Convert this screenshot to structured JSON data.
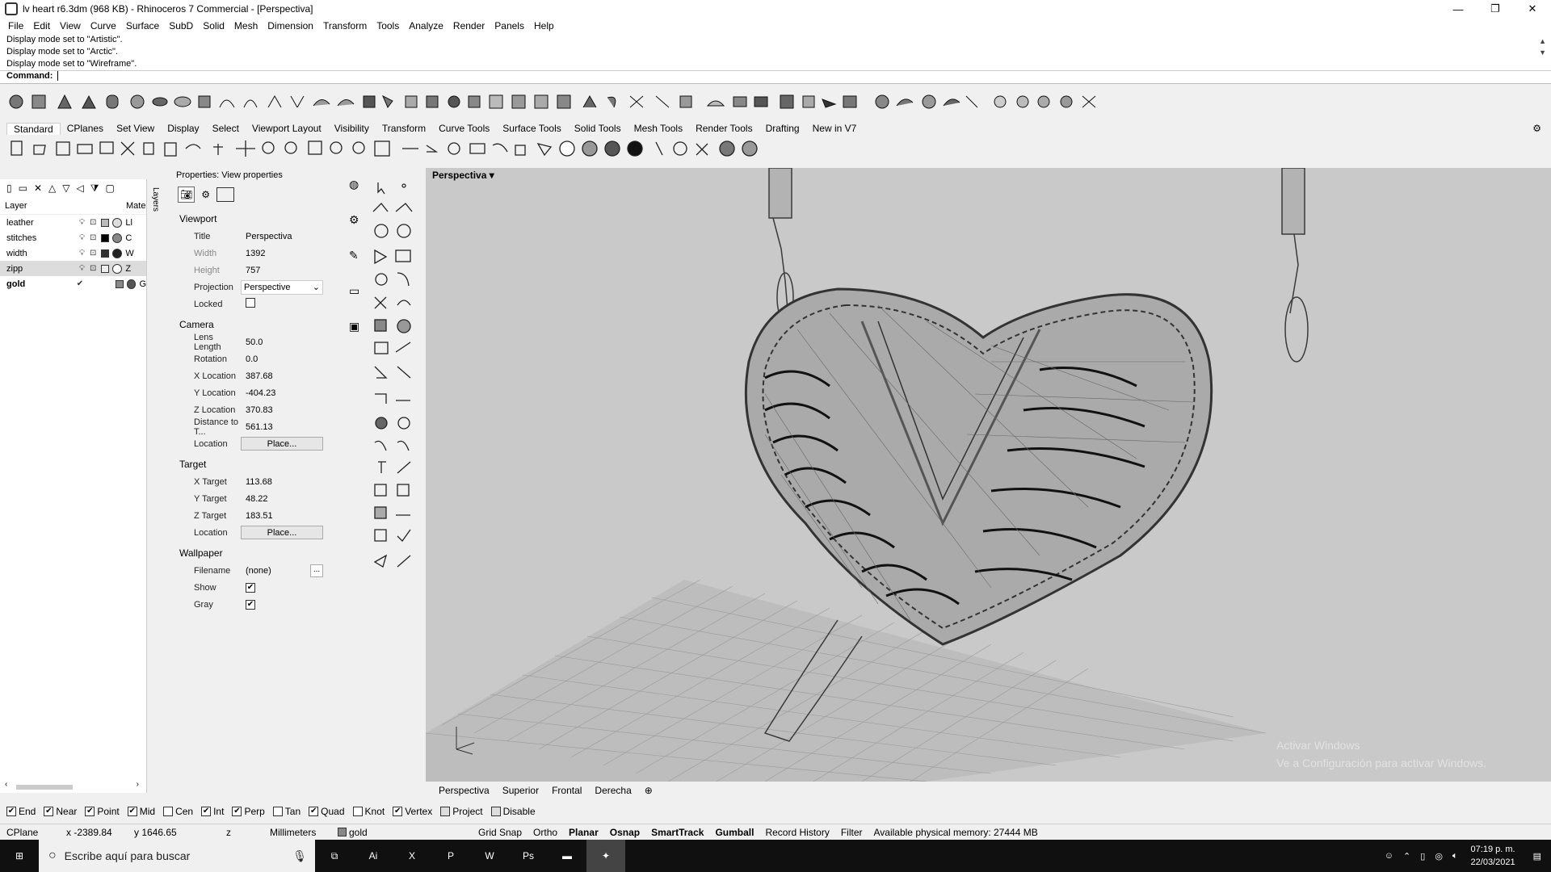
{
  "window": {
    "title": "lv heart r6.3dm (968 KB) - Rhinoceros 7 Commercial - [Perspectiva]",
    "minimize": "—",
    "restore": "❐",
    "close": "✕"
  },
  "menu": [
    "File",
    "Edit",
    "View",
    "Curve",
    "Surface",
    "SubD",
    "Solid",
    "Mesh",
    "Dimension",
    "Transform",
    "Tools",
    "Analyze",
    "Render",
    "Panels",
    "Help"
  ],
  "command_history": [
    "Display mode set to \"Artistic\".",
    "Display mode set to \"Arctic\".",
    "Display mode set to \"Wireframe\"."
  ],
  "command_prompt": "Command:",
  "toolbar_tabs": [
    "Standard",
    "CPlanes",
    "Set View",
    "Display",
    "Select",
    "Viewport Layout",
    "Visibility",
    "Transform",
    "Curve Tools",
    "Surface Tools",
    "Solid Tools",
    "Mesh Tools",
    "Render Tools",
    "Drafting",
    "New in V7"
  ],
  "layers": {
    "tab_label": "Layers",
    "col_layer": "Layer",
    "col_material": "Mate",
    "rows": [
      {
        "name": "leather",
        "mat": "Ll",
        "color": "#bbbbbb"
      },
      {
        "name": "stitches",
        "mat": "C",
        "color": "#000000"
      },
      {
        "name": "width",
        "mat": "W",
        "color": "#333333"
      },
      {
        "name": "zipp",
        "mat": "Z",
        "color": "#eeeeee"
      },
      {
        "name": "gold",
        "mat": "G",
        "color": "#555555"
      }
    ]
  },
  "properties": {
    "title": "Properties: View properties",
    "viewport_section": "Viewport",
    "title_label": "Title",
    "title_value": "Perspectiva",
    "width_label": "Width",
    "width_value": "1392",
    "height_label": "Height",
    "height_value": "757",
    "projection_label": "Projection",
    "projection_value": "Perspective",
    "locked_label": "Locked",
    "camera_section": "Camera",
    "lens_label": "Lens Length",
    "lens_value": "50.0",
    "rotation_label": "Rotation",
    "rotation_value": "0.0",
    "xloc_label": "X Location",
    "xloc_value": "387.68",
    "yloc_label": "Y Location",
    "yloc_value": "-404.23",
    "zloc_label": "Z Location",
    "zloc_value": "370.83",
    "dist_label": "Distance to T...",
    "dist_value": "561.13",
    "location_label": "Location",
    "place_label": "Place...",
    "target_section": "Target",
    "xt_label": "X Target",
    "xt_value": "113.68",
    "yt_label": "Y Target",
    "yt_value": "48.22",
    "zt_label": "Z Target",
    "zt_value": "183.51",
    "location2_label": "Location",
    "place2_label": "Place...",
    "wallpaper_section": "Wallpaper",
    "filename_label": "Filename",
    "filename_value": "(none)",
    "browse_label": "...",
    "show_label": "Show",
    "gray_label": "Gray"
  },
  "viewport": {
    "title": "Perspectiva",
    "tabs": [
      "Perspectiva",
      "Superior",
      "Frontal",
      "Derecha"
    ],
    "watermark_line1": "Activar Windows",
    "watermark_line2": "Ve a Configuración para activar Windows."
  },
  "osnaps": [
    {
      "label": "End",
      "checked": true
    },
    {
      "label": "Near",
      "checked": true
    },
    {
      "label": "Point",
      "checked": true
    },
    {
      "label": "Mid",
      "checked": true
    },
    {
      "label": "Cen",
      "checked": false
    },
    {
      "label": "Int",
      "checked": true
    },
    {
      "label": "Perp",
      "checked": true
    },
    {
      "label": "Tan",
      "checked": false
    },
    {
      "label": "Quad",
      "checked": true
    },
    {
      "label": "Knot",
      "checked": false
    },
    {
      "label": "Vertex",
      "checked": true
    },
    {
      "label": "Project",
      "checked": false
    },
    {
      "label": "Disable",
      "checked": false
    }
  ],
  "status": {
    "cplane": "CPlane",
    "x": "x -2389.84",
    "y": "y 1646.65",
    "z": "z",
    "units": "Millimeters",
    "layer": "gold",
    "grid_snap": "Grid Snap",
    "ortho": "Ortho",
    "planar": "Planar",
    "osnap": "Osnap",
    "smarttrack": "SmartTrack",
    "gumball": "Gumball",
    "record": "Record History",
    "filter": "Filter",
    "memory": "Available physical memory: 27444 MB"
  },
  "taskbar": {
    "search_placeholder": "Escribe aquí para buscar",
    "time": "07:19 p. m.",
    "date": "22/03/2021"
  }
}
